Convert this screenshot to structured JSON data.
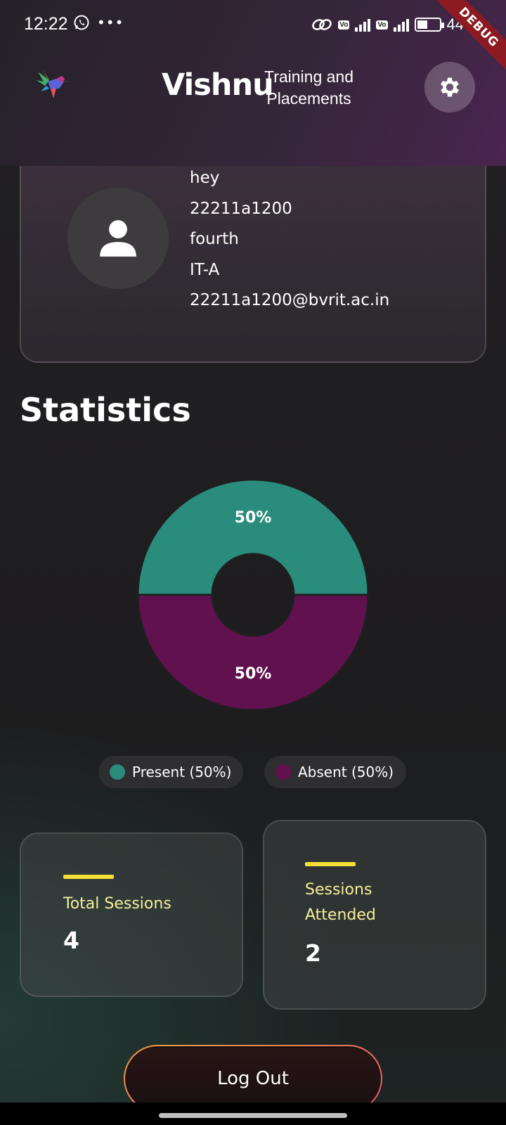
{
  "status_bar": {
    "time": "12:22",
    "battery_text": "44"
  },
  "debug_banner": "DEBUG",
  "header": {
    "brand_name": "Vishnu",
    "brand_subtitle_line1": "Training and",
    "brand_subtitle_line2": "Placements",
    "settings_icon": "gear-icon",
    "logo_icon": "hummingbird-logo"
  },
  "profile": {
    "name": "hey",
    "roll_number": "22211a1200",
    "year": "fourth",
    "section": "IT-A",
    "email": "22211a1200@bvrit.ac.in"
  },
  "statistics": {
    "title": "Statistics"
  },
  "chart_data": {
    "type": "pie",
    "categories": [
      "Present",
      "Absent"
    ],
    "values": [
      50,
      50
    ],
    "colors": [
      "#2a8c7b",
      "#62114f"
    ],
    "data_labels": [
      "50%",
      "50%"
    ],
    "legend": [
      "Present (50%)",
      "Absent (50%)"
    ]
  },
  "stats_cards": {
    "total_sessions_label": "Total Sessions",
    "total_sessions_value": "4",
    "sessions_attended_label_line1": "Sessions",
    "sessions_attended_label_line2": "Attended",
    "sessions_attended_value": "2"
  },
  "logout_label": "Log Out"
}
